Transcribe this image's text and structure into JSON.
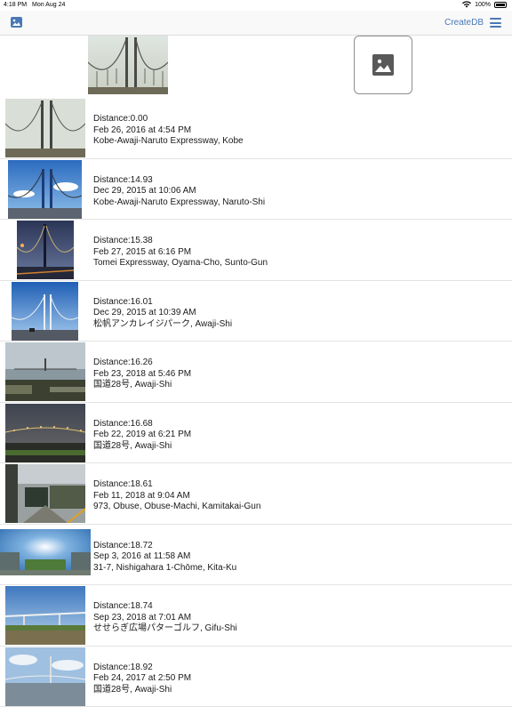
{
  "status_bar": {
    "time": "4:18 PM",
    "date": "Mon Aug 24",
    "battery": "100%"
  },
  "nav": {
    "create_db_label": "CreateDB",
    "photo_icon": "photo-icon",
    "menu_icon": "hamburger-menu-icon"
  },
  "query": {
    "thumbnail": "bridge-photo",
    "pick_icon": "image-placeholder-icon"
  },
  "results": [
    {
      "distance": "Distance:0.00",
      "date": "Feb 26, 2016 at 4:54 PM",
      "place": "Kobe-Awaji-Naruto Expressway, Kobe"
    },
    {
      "distance": "Distance:14.93",
      "date": "Dec 29, 2015 at 10:06 AM",
      "place": "Kobe-Awaji-Naruto Expressway, Naruto-Shi"
    },
    {
      "distance": "Distance:15.38",
      "date": "Feb 27, 2015 at 6:16 PM",
      "place": "Tomei Expressway, Oyama-Cho, Sunto-Gun"
    },
    {
      "distance": "Distance:16.01",
      "date": "Dec 29, 2015 at 10:39 AM",
      "place": "松帆アンカレイジパーク, Awaji-Shi"
    },
    {
      "distance": "Distance:16.26",
      "date": "Feb 23, 2018 at 5:46 PM",
      "place": "国道28号, Awaji-Shi"
    },
    {
      "distance": "Distance:16.68",
      "date": "Feb 22, 2019 at 6:21 PM",
      "place": "国道28号, Awaji-Shi"
    },
    {
      "distance": "Distance:18.61",
      "date": "Feb 11, 2018 at 9:04 AM",
      "place": "973, Obuse, Obuse-Machi, Kamitakai-Gun"
    },
    {
      "distance": "Distance:18.72",
      "date": "Sep 3, 2016 at 11:58 AM",
      "place": "31-7, Nishigahara 1-Chōme, Kita-Ku"
    },
    {
      "distance": "Distance:18.74",
      "date": "Sep 23, 2018 at 7:01 AM",
      "place": "せせらぎ広場パターゴルフ, Gifu-Shi"
    },
    {
      "distance": "Distance:18.92",
      "date": "Feb 24, 2017 at 2:50 PM",
      "place": "国道28号, Awaji-Shi"
    }
  ]
}
